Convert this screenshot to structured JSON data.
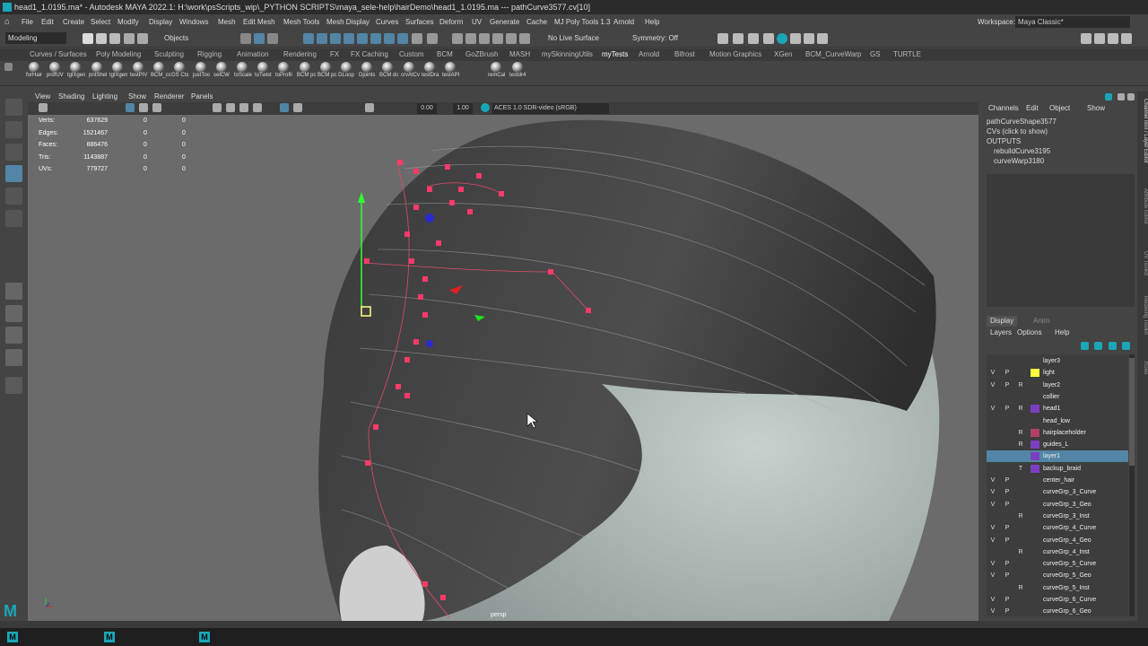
{
  "title_bar": {
    "text": "head1_1.0195.ma* - Autodesk MAYA 2022.1: H:\\work\\psScripts_wip\\_PYTHON SCRIPTS\\maya_sele-help\\hairDemo\\head1_1.0195.ma  ---  pathCurve3577.cv[10]"
  },
  "menu": {
    "items": [
      "File",
      "Edit",
      "Create",
      "Select",
      "Modify",
      "Display",
      "Windows",
      "Mesh",
      "Edit Mesh",
      "Mesh Tools",
      "Mesh Display",
      "Curves",
      "Surfaces",
      "Deform",
      "UV",
      "Generate",
      "Cache",
      "MJ Poly Tools 1.3",
      "Arnold",
      "Help"
    ],
    "workspace_label": "Workspace:",
    "workspace_value": "Maya Classic*"
  },
  "status_line": {
    "mode": "Modeling",
    "selection_mode": "Objects",
    "live_surface": "No Live Surface",
    "symmetry": "Symmetry: Off"
  },
  "shelf": {
    "tabs": [
      "Curves / Surfaces",
      "Poly Modeling",
      "Sculpting",
      "Rigging",
      "Animation",
      "Rendering",
      "FX",
      "FX Caching",
      "Custom",
      "BCM",
      "GoZBrush",
      "MASH",
      "mySkinningUtils",
      "myTests",
      "Arnold",
      "Bifrost",
      "Motion Graphics",
      "XGen",
      "BCM_CurveWarp",
      "GS",
      "TURTLE"
    ],
    "active_tab": "myTests",
    "buttons": [
      "forHair",
      "prdfUV",
      "tglXgen",
      "pntShel",
      "tglXgen",
      "testPIV",
      "BCM_cc",
      "GS Ctx",
      "justToo",
      "selCW",
      "toScale",
      "toTwist",
      "toProfil",
      "BCM pc",
      "BCM pc",
      "DLoop",
      "Djoints",
      "BCM dc",
      "crvAtCv",
      "testDra",
      "testAPI",
      "remCal",
      "testdr4"
    ]
  },
  "viewport": {
    "menu": [
      "View",
      "Shading",
      "Lighting",
      "Show",
      "Renderer",
      "Panels"
    ],
    "toolbar": {
      "value_a": "0.00",
      "value_b": "1.00",
      "color_space": "ACES 1.0 SDR-video (sRGB)"
    },
    "hud": [
      {
        "label": "Verts:",
        "v1": "637629",
        "v2": "0",
        "v3": "0"
      },
      {
        "label": "Edges:",
        "v1": "1521467",
        "v2": "0",
        "v3": "0"
      },
      {
        "label": "Faces:",
        "v1": "886476",
        "v2": "0",
        "v3": "0"
      },
      {
        "label": "Tris:",
        "v1": "1143887",
        "v2": "0",
        "v3": "0"
      },
      {
        "label": "UVs:",
        "v1": "779727",
        "v2": "0",
        "v3": "0"
      }
    ],
    "camera": "persp"
  },
  "channel_box": {
    "menu": [
      "Channels",
      "Edit",
      "Object",
      "Show"
    ],
    "shape": "pathCurveShape3577",
    "cvs": "CVs (click to show)",
    "outputs_label": "OUTPUTS",
    "outputs": [
      "rebuildCurve3195",
      "curveWarp3180"
    ]
  },
  "layer_editor": {
    "tabs": [
      "Display",
      "Anim"
    ],
    "menu": [
      "Layers",
      "Options",
      "Help"
    ],
    "layers": [
      {
        "v": "",
        "p": "",
        "r": "",
        "color": "",
        "name": "layer3"
      },
      {
        "v": "V",
        "p": "P",
        "r": "",
        "color": "#ffff40",
        "name": "light"
      },
      {
        "v": "V",
        "p": "P",
        "r": "R",
        "color": "",
        "name": "layer2"
      },
      {
        "v": "",
        "p": "",
        "r": "",
        "color": "",
        "name": "collier"
      },
      {
        "v": "V",
        "p": "P",
        "r": "R",
        "color": "#7a3fbf",
        "name": "head1"
      },
      {
        "v": "",
        "p": "",
        "r": "",
        "color": "",
        "name": "head_low"
      },
      {
        "v": "",
        "p": "",
        "r": "R",
        "color": "#b0406a",
        "name": "hairplaceholder"
      },
      {
        "v": "",
        "p": "",
        "r": "R",
        "color": "#7a3fbf",
        "name": "guides_L"
      },
      {
        "v": "",
        "p": "",
        "r": "",
        "color": "#7a3fbf",
        "name": "layer1",
        "selected": true
      },
      {
        "v": "",
        "p": "",
        "r": "T",
        "color": "#7a3fbf",
        "name": "backup_braid"
      },
      {
        "v": "V",
        "p": "P",
        "r": "",
        "color": "",
        "name": "center_hair"
      },
      {
        "v": "V",
        "p": "P",
        "r": "",
        "color": "",
        "name": "curveGrp_3_Curve"
      },
      {
        "v": "V",
        "p": "P",
        "r": "",
        "color": "",
        "name": "curveGrp_3_Geo"
      },
      {
        "v": "",
        "p": "",
        "r": "R",
        "color": "",
        "name": "curveGrp_3_Inst"
      },
      {
        "v": "V",
        "p": "P",
        "r": "",
        "color": "",
        "name": "curveGrp_4_Curve"
      },
      {
        "v": "V",
        "p": "P",
        "r": "",
        "color": "",
        "name": "curveGrp_4_Geo"
      },
      {
        "v": "",
        "p": "",
        "r": "R",
        "color": "",
        "name": "curveGrp_4_Inst"
      },
      {
        "v": "V",
        "p": "P",
        "r": "",
        "color": "",
        "name": "curveGrp_5_Curve"
      },
      {
        "v": "V",
        "p": "P",
        "r": "",
        "color": "",
        "name": "curveGrp_5_Geo"
      },
      {
        "v": "",
        "p": "",
        "r": "R",
        "color": "",
        "name": "curveGrp_5_Inst"
      },
      {
        "v": "V",
        "p": "P",
        "r": "",
        "color": "",
        "name": "curveGrp_6_Curve"
      },
      {
        "v": "V",
        "p": "P",
        "r": "",
        "color": "",
        "name": "curveGrp_6_Geo"
      }
    ]
  },
  "side_tabs": [
    "Channel Box / Layer Editor",
    "Attribute Editor",
    "UV Toolkit",
    "Modeling Toolkit",
    "XGen"
  ],
  "taskbar": {
    "icon_letter": "M"
  }
}
